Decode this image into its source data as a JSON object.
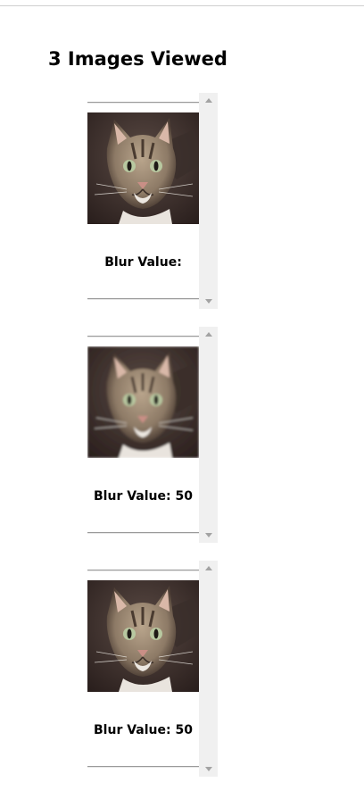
{
  "page": {
    "title": "3 Images Viewed"
  },
  "viewer_cards": [
    {
      "blur_label": "Blur Value:",
      "image_icon": "cat-photo"
    },
    {
      "blur_label": "Blur Value: 50",
      "image_icon": "cat-photo"
    },
    {
      "blur_label": "Blur Value: 50",
      "image_icon": "cat-photo"
    }
  ],
  "colors": {
    "scrollbar_track": "#f0f0f0",
    "scroll_arrow": "#a3a3a3",
    "rule": "#9a9a9a"
  }
}
